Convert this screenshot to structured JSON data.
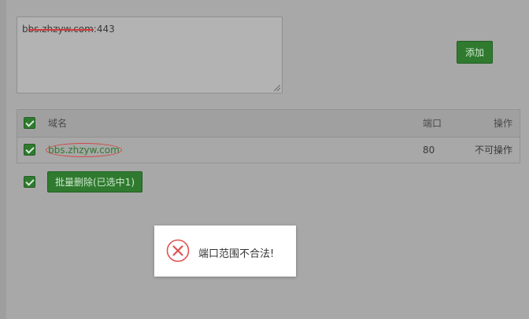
{
  "textarea": {
    "value_prefix": "b",
    "value_struck": "bs.zhzyw.com",
    "value_suffix": ":443"
  },
  "add_button": {
    "label": "添加"
  },
  "table": {
    "headers": {
      "domain": "域名",
      "port": "端口",
      "action": "操作"
    },
    "rows": [
      {
        "domain": "bbs.zhzyw.com",
        "port": "80",
        "action": "不可操作",
        "checked": true
      }
    ]
  },
  "batch_delete": {
    "label": "批量删除(已选中1)"
  },
  "toast": {
    "message": "端口范围不合法!",
    "icon": "error-x-icon"
  },
  "colors": {
    "accent": "#2f7a2f",
    "error": "#e05252"
  }
}
